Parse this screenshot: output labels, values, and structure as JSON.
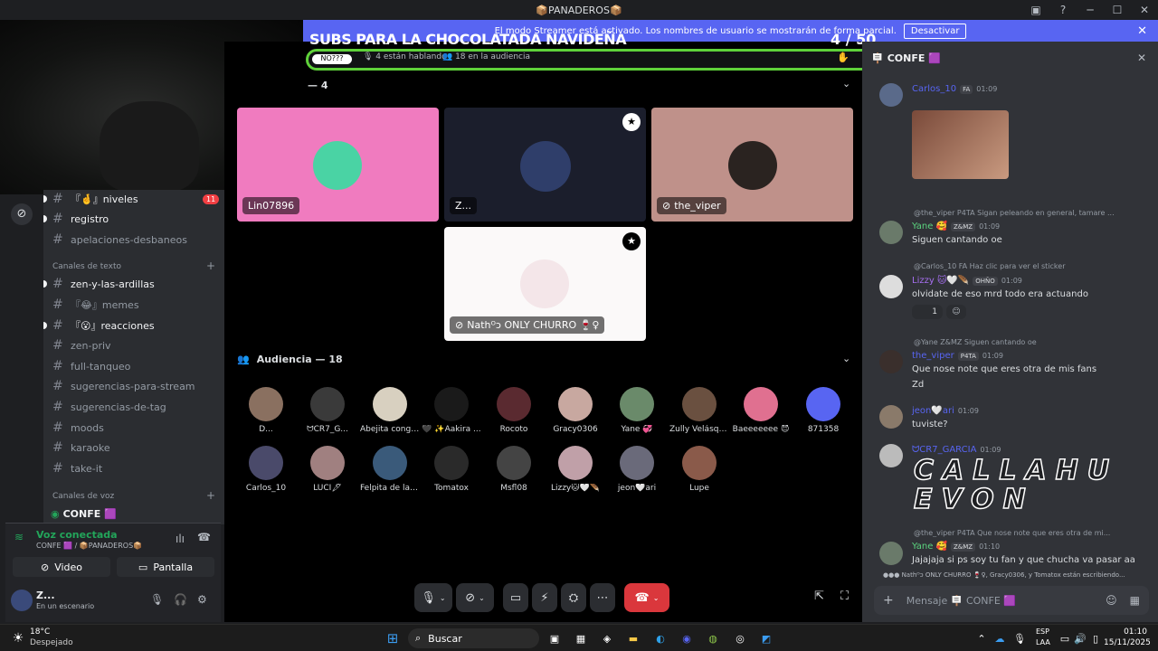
{
  "titlebar": {
    "title": "📦PANADEROS📦"
  },
  "streamer_banner": {
    "text": "El modo Streamer está activado. Los nombres de usuario se mostrarán de forma parcial.",
    "button": "Desactivar"
  },
  "stage": {
    "title": "SUBS PARA LA CHOCOLATADA NAVIDEÑA",
    "count": "4",
    "max": "/ 50",
    "topic": "NO???",
    "speaking": "4 están hablando",
    "audience": "18 en la audiencia",
    "speakers_header": "— 4"
  },
  "speakers": [
    {
      "name": "Lin07896",
      "bg": "#f07bbf"
    },
    {
      "name": "Z...",
      "bg": "#1b1e2c"
    },
    {
      "name": "the_viper",
      "bg": "#bf918a"
    },
    {
      "name": "Nathᴼᴐ ONLY CHURRO 🍷♀",
      "bg": "#fbf9f9"
    }
  ],
  "audience_header": "Audiencia — 18",
  "audience": [
    [
      "D...",
      "ᗢCR7_G...",
      "Abejita conge...",
      "🖤 ✨Aakira ...",
      "Rocoto",
      "Gracy0306",
      "Yane 💞",
      "Zully Velásquez",
      "Baeeeeeee 😈",
      "871358"
    ],
    [
      "Carlos_10",
      "LUCI🖋",
      "Felpita de la ...",
      "Tomatox",
      "Msfl08",
      "Lizzy🐱🤍🪶",
      "jeon🤍ari",
      "Lupe"
    ]
  ],
  "sidebar": {
    "channels_top": [
      {
        "label": "『🤞』niveles",
        "badge": "11",
        "bold": true
      },
      {
        "label": "registro",
        "bold": true
      },
      {
        "label": "apelaciones-desbaneos",
        "bold": false
      }
    ],
    "text_category": "Canales de texto",
    "channels": [
      {
        "label": "zen-y-las-ardillas",
        "bold": true
      },
      {
        "label": "『😂』memes",
        "bold": false
      },
      {
        "label": "『😮』reacciones",
        "bold": true
      },
      {
        "label": "zen-priv",
        "bold": false
      },
      {
        "label": "full-tanqueo",
        "bold": false
      },
      {
        "label": "sugerencias-para-stream",
        "bold": false
      },
      {
        "label": "sugerencias-de-tag",
        "bold": false
      },
      {
        "label": "moods",
        "bold": false
      },
      {
        "label": "karaoke",
        "bold": false
      },
      {
        "label": "take-it",
        "bold": false
      }
    ],
    "voice_category": "Canales de voz",
    "voice_channel": "CONFE 🟪"
  },
  "voice": {
    "status": "Voz conectada",
    "location": "CONFE 🟪 / 📦PANADEROS📦",
    "video": "Video",
    "screen": "Pantalla"
  },
  "user": {
    "name": "Z...",
    "status": "En un escenario"
  },
  "chat": {
    "title": "CONFE 🟪",
    "placeholder": "Mensaje 🪧 CONFE 🟪",
    "typing": "Nathᴼᴐ ONLY CHURRO 🍷♀, Gracy0306, y Tomatox están escribiendo...",
    "messages": [
      {
        "author": "Carlos_10",
        "tag": "FA",
        "time": "01:09",
        "text": ""
      },
      {
        "reply": "@the_viper P4TA Sigan peleando en general, tamare ...",
        "author": "Yane 🥰",
        "tag": "Z&MZ",
        "time": "01:09",
        "text": "Siguen cantando oe"
      },
      {
        "reply": "@Carlos_10 FA Haz clic para ver el sticker",
        "author": "Lizzy 🐱🤍🪶",
        "tag": "OHÑO",
        "time": "01:09",
        "text": "olvidate de eso mrd todo era actuando",
        "reaction": "1"
      },
      {
        "reply": "@Yane Z&MZ Siguen cantando oe",
        "author": "the_viper",
        "tag": "P4TA",
        "time": "01:09",
        "text": "Que nose note que eres otra de mis fans",
        "text2": "Zd"
      },
      {
        "author": "jeon🤍ari",
        "time": "01:09",
        "text": "tuviste?"
      },
      {
        "author": "ᗢCR7_GARCIA",
        "time": "01:09",
        "text": "CALLAHU EVON"
      },
      {
        "reply": "@the_viper P4TA Que nose note que eres otra de mi...",
        "author": "Yane 🥰",
        "tag": "Z&MZ",
        "time": "01:10",
        "text": "Jajajaja si ps soy tu fan y que chucha va pasar aa"
      }
    ]
  },
  "taskbar": {
    "temp": "18°C",
    "weather": "Despejado",
    "search": "Buscar",
    "lang": "ESP",
    "lang2": "LAA",
    "time": "01:10",
    "date": "15/11/2025"
  }
}
